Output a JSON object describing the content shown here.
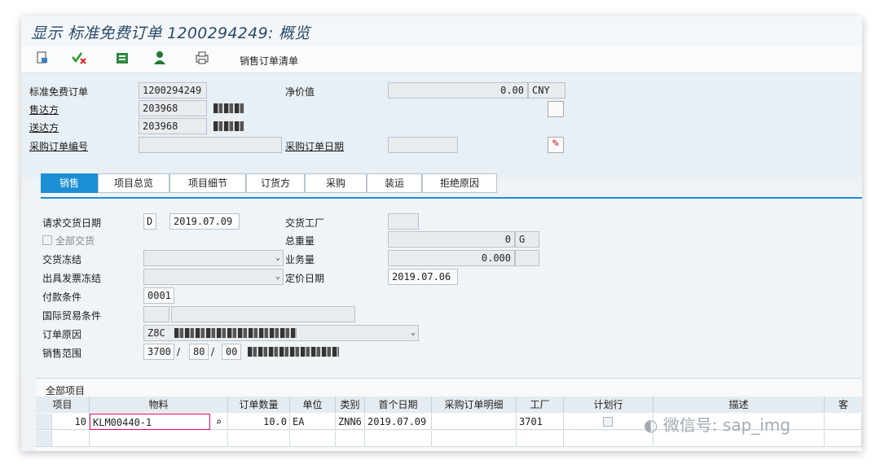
{
  "window": {
    "title": "显示 标准免费订单 1200294249: 概览"
  },
  "toolbar": {
    "icons": [
      "document-icon",
      "check-cancel-icon",
      "customer-icon",
      "person-icon",
      "print-icon"
    ],
    "sales_order_list": "销售订单清单"
  },
  "header": {
    "doc_type_label": "标准免费订单",
    "doc_number": "1200294249",
    "net_value_label": "净价值",
    "net_value": "0.00",
    "currency": "CNY",
    "sold_to_label": "售达方",
    "sold_to_value": "203968",
    "ship_to_label": "送达方",
    "ship_to_value": "203968",
    "po_number_label": "采购订单编号",
    "po_number": "",
    "po_date_label": "采购订单日期",
    "po_date": ""
  },
  "tabs": [
    {
      "label": "销售",
      "active": true
    },
    {
      "label": "项目总览"
    },
    {
      "label": "项目细节"
    },
    {
      "label": "订货方"
    },
    {
      "label": "采购"
    },
    {
      "label": "装运"
    },
    {
      "label": "拒绝原因"
    }
  ],
  "sales_tab": {
    "req_delivery_date_label": "请求交货日期",
    "req_delivery_date_type": "D",
    "req_delivery_date": "2019.07.09",
    "complete_delivery_label": "全部交货",
    "delivery_block_label": "交货冻结",
    "billing_block_label": "出具发票冻结",
    "payment_terms_label": "付款条件",
    "payment_terms": "0001",
    "incoterms_label": "国际贸易条件",
    "order_reason_label": "订单原因",
    "order_reason_code": "Z8C",
    "sales_area_label": "销售范围",
    "sales_org": "3700",
    "dist_channel": "80",
    "division": "00",
    "separator": "/",
    "plant_label": "交货工厂",
    "gross_weight_label": "总重量",
    "gross_weight": "0",
    "weight_unit": "G",
    "volume_label": "业务量",
    "volume": "0.000",
    "pricing_date_label": "定价日期",
    "pricing_date": "2019.07.06"
  },
  "items_table": {
    "title": "全部项目",
    "columns": [
      "项目",
      "物料",
      "订单数量",
      "单位",
      "类别",
      "首个日期",
      "采购订单明细",
      "工厂",
      "计划行",
      "描述",
      "客"
    ],
    "rows": [
      {
        "item": "10",
        "material": "KLM00440-1",
        "qty": "10.0",
        "unit": "EA",
        "category": "ZNN6",
        "first_date": "2019.07.09",
        "po_item": "",
        "plant": "3701"
      }
    ]
  },
  "watermark": "微信号: sap_img"
}
